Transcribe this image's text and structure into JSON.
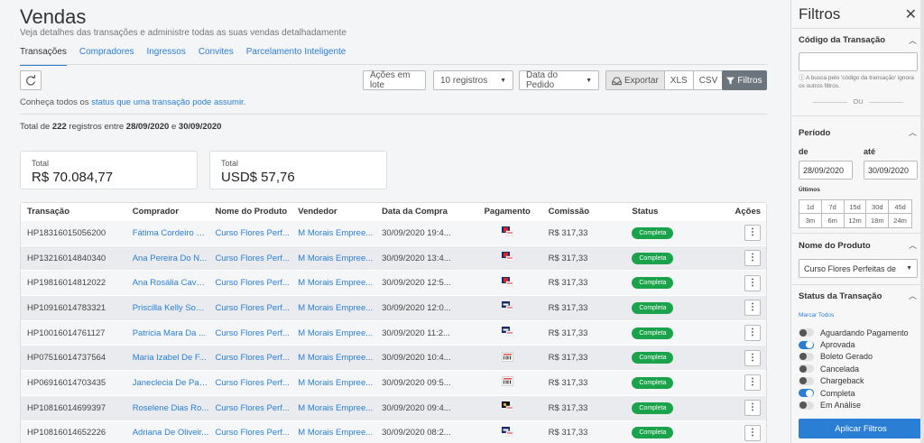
{
  "header": {
    "title": "Vendas",
    "subtitle": "Veja detalhes das transações e administre todas as suas vendas detalhadamente"
  },
  "tabs": [
    {
      "label": "Transações"
    },
    {
      "label": "Compradores"
    },
    {
      "label": "Ingressos"
    },
    {
      "label": "Convites"
    },
    {
      "label": "Parcelamento Inteligente"
    }
  ],
  "toolbar": {
    "batch_actions": "Ações em lote",
    "records_select": "10 registros",
    "date_select": "Data do Pedido",
    "export_label": "Exportar",
    "xls": "XLS",
    "csv": "CSV",
    "filters": "Filtros"
  },
  "status_info": {
    "prefix": "Conheça todos os",
    "link": "status que uma transação pode assumir",
    "suffix": "."
  },
  "summary": {
    "prefix": "Total de",
    "count": "222",
    "mid1": "registros entre",
    "date_from": "28/09/2020",
    "mid2": "e",
    "date_to": "30/09/2020"
  },
  "totals": [
    {
      "label": "Total",
      "value": "R$ 70.084,77"
    },
    {
      "label": "Total",
      "value": "USD$ 57,76"
    }
  ],
  "table": {
    "columns": [
      "Transação",
      "Comprador",
      "Nome do Produto",
      "Vendedor",
      "Data da Compra",
      "Pagamento",
      "Comissão",
      "Status",
      "Ações"
    ],
    "rows": [
      {
        "id": "HP18316015056200",
        "buyer": "Fátima Cordeiro D...",
        "product": "Curso Flores Perf...",
        "seller": "M Morais Empree...",
        "date": "30/09/2020 19:4...",
        "payment": "card-red",
        "commission": "R$ 317,33",
        "status": "Completa"
      },
      {
        "id": "HP13216014840340",
        "buyer": "Ana Pereira Do N...",
        "product": "Curso Flores Perf...",
        "seller": "M Morais Empree...",
        "date": "30/09/2020 13:4...",
        "payment": "card-red",
        "commission": "R$ 317,33",
        "status": "Completa"
      },
      {
        "id": "HP19816014812022",
        "buyer": "Ana Rosália Caval...",
        "product": "Curso Flores Perf...",
        "seller": "M Morais Empree...",
        "date": "30/09/2020 12:5...",
        "payment": "card-red",
        "commission": "R$ 317,33",
        "status": "Completa"
      },
      {
        "id": "HP10916014783321",
        "buyer": "Priscilla Kelly Soar...",
        "product": "Curso Flores Perf...",
        "seller": "M Morais Empree...",
        "date": "30/09/2020 12:0...",
        "payment": "card-blue",
        "commission": "R$ 317,33",
        "status": "Completa"
      },
      {
        "id": "HP10016014761127",
        "buyer": "Patricia Mara Da ...",
        "product": "Curso Flores Perf...",
        "seller": "M Morais Empree...",
        "date": "30/09/2020 11:2...",
        "payment": "card-blue",
        "commission": "R$ 317,33",
        "status": "Completa"
      },
      {
        "id": "HP07516014737564",
        "buyer": "Maria Izabel De F...",
        "product": "Curso Flores Perf...",
        "seller": "M Morais Empree...",
        "date": "30/09/2020 10:4...",
        "payment": "boleto",
        "commission": "R$ 317,33",
        "status": "Completa"
      },
      {
        "id": "HP06916014703435",
        "buyer": "Janeclecia De Paul...",
        "product": "Curso Flores Perf...",
        "seller": "M Morais Empree...",
        "date": "30/09/2020 09:5...",
        "payment": "boleto",
        "commission": "R$ 317,33",
        "status": "Completa"
      },
      {
        "id": "HP10816014699397",
        "buyer": "Roselene Dias Ro...",
        "product": "Curso Flores Perf...",
        "seller": "M Morais Empree...",
        "date": "30/09/2020 09:4...",
        "payment": "card-black",
        "commission": "R$ 317,33",
        "status": "Completa"
      },
      {
        "id": "HP10816014652226",
        "buyer": "Adriana De Oliveir...",
        "product": "Curso Flores Perf...",
        "seller": "M Morais Empree...",
        "date": "30/09/2020 08:2...",
        "payment": "card-blue",
        "commission": "R$ 317,33",
        "status": "Completa"
      }
    ],
    "action_glyph": "⋮"
  },
  "sidebar": {
    "title": "Filtros",
    "close": "✕",
    "transaction_code": {
      "title": "Código da Transação",
      "value": "",
      "hint": "ⓘ A busca pelo 'código da transação' ignora os outros filtros.",
      "or": "OU"
    },
    "period": {
      "title": "Período",
      "from_label": "de",
      "to_label": "até",
      "from_value": "28/09/2020",
      "to_value": "30/09/2020",
      "last_label": "Últimos",
      "options": [
        "1d",
        "7d",
        "15d",
        "30d",
        "45d",
        "3m",
        "6m",
        "12m",
        "18m",
        "24m"
      ]
    },
    "product": {
      "title": "Nome do Produto",
      "value": "Curso Flores Perfeitas de"
    },
    "status": {
      "title": "Status da Transação",
      "mark_all": "Marcar Todos",
      "items": [
        {
          "label": "Aguardando Pagamento",
          "on": false
        },
        {
          "label": "Aprovada",
          "on": true
        },
        {
          "label": "Boleto Gerado",
          "on": false
        },
        {
          "label": "Cancelada",
          "on": false
        },
        {
          "label": "Chargeback",
          "on": false
        },
        {
          "label": "Completa",
          "on": true
        },
        {
          "label": "Em Análise",
          "on": false
        }
      ]
    },
    "apply": "Aplicar Filtros"
  },
  "colors": {
    "accent": "#2a7fd4",
    "status_green": "#1aa34a",
    "filters_button": "#6c757d"
  }
}
